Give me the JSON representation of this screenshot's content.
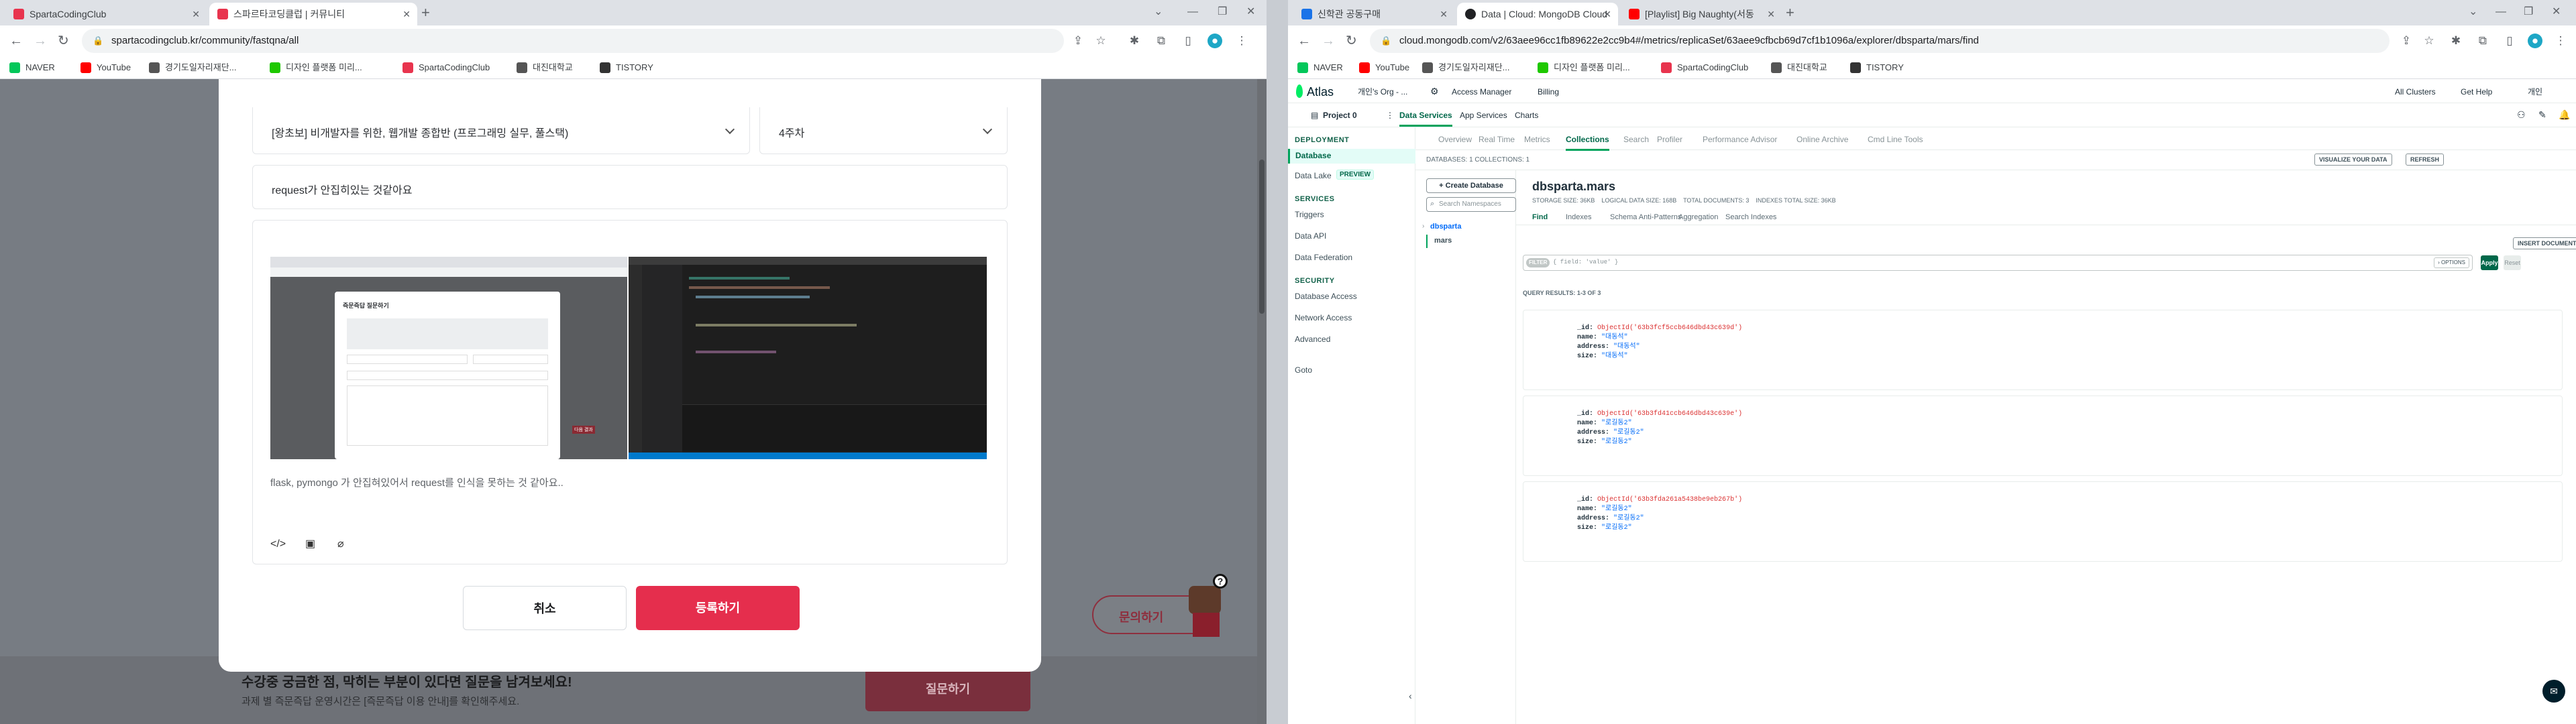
{
  "left_window": {
    "tabs": [
      {
        "title": "SpartaCodingClub",
        "active": false,
        "favicon_color": "#e8344e"
      },
      {
        "title": "스파르타코딩클럽 | 커뮤니티",
        "active": true,
        "favicon_color": "#e8344e"
      }
    ],
    "url": "spartacodingclub.kr/community/fastqna/all",
    "bookmarks": [
      {
        "label": "NAVER",
        "color": "#03c75a"
      },
      {
        "label": "YouTube",
        "color": "#ff0000"
      },
      {
        "label": "경기도일자리재단...",
        "color": "#555555"
      },
      {
        "label": "디자인 플랫폼 미리...",
        "color": "#1ec800"
      },
      {
        "label": "SpartaCodingClub",
        "color": "#e8344e"
      },
      {
        "label": "대진대학교",
        "color": "#555555"
      },
      {
        "label": "TISTORY",
        "color": "#333333"
      }
    ],
    "modal": {
      "course_select": "[왕초보] 비개발자를 위한, 웹개발 종합반 (프로그래밍 실무, 풀스택)",
      "week_select": "4주차",
      "title_value": "request가 안집히있는 것같아요",
      "body_text": "flask, pymongo 가 안집혀있어서 request를 인식을 못하는 것 같아요..",
      "screenshot1": {
        "dialog_title": "즉문즉답 질문하기",
        "side_label": "다음 결과"
      },
      "toolbar_icons": [
        "code-icon",
        "image-icon",
        "attach-icon"
      ],
      "cancel_label": "취소",
      "submit_label": "등록하기"
    },
    "behind": {
      "headline": "수강중 궁금한 점, 막히는 부분이 있다면 질문을 남겨보세요!",
      "subtext": "과제 별 즉문즉답 운영시간은 [즉문즉답 이용 안내]를 확인해주세요.",
      "ask_button": "질문하기",
      "inquiry_button": "문의하기"
    }
  },
  "right_window": {
    "tabs": [
      {
        "title": "신학관 공동구매",
        "active": false,
        "favicon_color": "#1a73e8"
      },
      {
        "title": "Data | Cloud: MongoDB Cloud",
        "active": true,
        "favicon_color": "#202124"
      },
      {
        "title": "[Playlist] Big Naughty(서동",
        "active": false,
        "favicon_color": "#ff0000"
      }
    ],
    "url": "cloud.mongodb.com/v2/63aee96cc1fb89622e2cc9b4#/metrics/replicaSet/63aee9cfbcb69d7cf1b1096a/explorer/dbsparta/mars/find",
    "bookmarks": [
      {
        "label": "NAVER",
        "color": "#03c75a"
      },
      {
        "label": "YouTube",
        "color": "#ff0000"
      },
      {
        "label": "경기도일자리재단...",
        "color": "#555555"
      },
      {
        "label": "디자인 플랫폼 미리...",
        "color": "#1ec800"
      },
      {
        "label": "SpartaCodingClub",
        "color": "#e8344e"
      },
      {
        "label": "대진대학교",
        "color": "#555555"
      },
      {
        "label": "TISTORY",
        "color": "#333333"
      }
    ],
    "atlas": {
      "logo": "Atlas",
      "org": "개인's Org - ...",
      "access_manager": "Access Manager",
      "billing": "Billing",
      "all_clusters": "All Clusters",
      "get_help": "Get Help",
      "user": "개인",
      "project": "Project 0",
      "sub_tabs": [
        "Data Services",
        "App Services",
        "Charts"
      ],
      "sidebar": {
        "deployment": "DEPLOYMENT",
        "database": "Database",
        "data_lake": "Data Lake",
        "preview": "PREVIEW",
        "services": "SERVICES",
        "triggers": "Triggers",
        "data_api": "Data API",
        "data_federation": "Data Federation",
        "security": "SECURITY",
        "database_access": "Database Access",
        "network_access": "Network Access",
        "advanced": "Advanced",
        "goto": "Goto"
      },
      "cluster_tabs": [
        "Overview",
        "Real Time",
        "Metrics",
        "Collections",
        "Search",
        "Profiler",
        "Performance Advisor",
        "Online Archive",
        "Cmd Line Tools"
      ],
      "databases_count": "DATABASES: 1   COLLECTIONS: 1",
      "visualize": "VISUALIZE YOUR DATA",
      "refresh": "REFRESH",
      "create_db": "+ Create Database",
      "search_ns": "Search Namespaces",
      "db_name": "dbsparta",
      "coll_name": "mars",
      "ns_title": "dbsparta.mars",
      "stats": "STORAGE SIZE: 36KB    LOGICAL DATA SIZE: 168B    TOTAL DOCUMENTS: 3    INDEXES TOTAL SIZE: 36KB",
      "coll_tabs": [
        "Find",
        "Indexes",
        "Schema Anti-Patterns",
        "Aggregation",
        "Search Indexes"
      ],
      "insert_doc": "INSERT DOCUMENT",
      "filter_label": "FILTER",
      "filter_placeholder": "{ field: 'value' }",
      "options": "› OPTIONS",
      "apply": "Apply",
      "reset": "Reset",
      "results": "QUERY RESULTS: 1-3 OF 3",
      "documents": [
        {
          "id": "ObjectId('63b3fcf5ccb646dbd43c639d')",
          "name": "\"대동석\"",
          "address": "\"대동석\"",
          "size": "\"대동석\""
        },
        {
          "id": "ObjectId('63b3fd41ccb646dbd43c639e')",
          "name": "\"로길동2\"",
          "address": "\"로길동2\"",
          "size": "\"로길동2\""
        },
        {
          "id": "ObjectId('63b3fda261a5438be9eb267b')",
          "name": "\"로길동2\"",
          "address": "\"로길동2\"",
          "size": "\"로길동2\""
        }
      ]
    }
  }
}
